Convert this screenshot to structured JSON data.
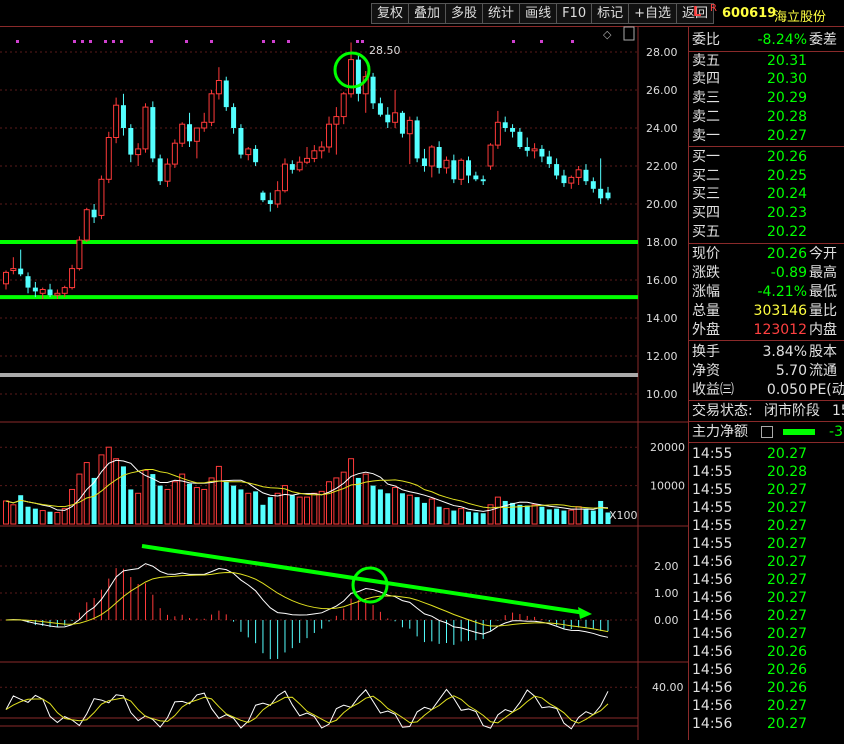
{
  "toolbar": {
    "buttons": [
      "复权",
      "叠加",
      "多股",
      "统计",
      "画线",
      "F10",
      "标记",
      "+自选",
      "返回"
    ],
    "mode_label": "L",
    "mode_r": "R",
    "stock_code": "600619",
    "stock_name": "海立股份"
  },
  "colors": {
    "up": "#ff3a3a",
    "down": "#54ffff",
    "green": "#00ff00",
    "yellow": "#e0e020",
    "white": "#ffffff"
  },
  "main_chart": {
    "high_label": "28.50",
    "price_axis": [
      "28.00",
      "26.00",
      "24.00",
      "22.00",
      "20.00",
      "18.00",
      "16.00",
      "14.00",
      "12.00",
      "10.00"
    ],
    "support_lines": [
      18.0,
      15.1
    ],
    "gray_line": 11.0
  },
  "volume_chart": {
    "axis": [
      "20000",
      "10000"
    ],
    "unit_label": "X100"
  },
  "macd_chart": {
    "axis": [
      "2.00",
      "1.00",
      "0.00"
    ]
  },
  "kdj_chart": {
    "axis": [
      "40.00"
    ]
  },
  "order_book": {
    "weibi_label": "委比",
    "weibi_value": "-8.24%",
    "weicha_label": "委差",
    "sells": [
      {
        "label": "卖五",
        "price": "20.31"
      },
      {
        "label": "卖四",
        "price": "20.30"
      },
      {
        "label": "卖三",
        "price": "20.29"
      },
      {
        "label": "卖二",
        "price": "20.28"
      },
      {
        "label": "卖一",
        "price": "20.27"
      }
    ],
    "buys": [
      {
        "label": "买一",
        "price": "20.26"
      },
      {
        "label": "买二",
        "price": "20.25"
      },
      {
        "label": "买三",
        "price": "20.24"
      },
      {
        "label": "买四",
        "price": "20.23"
      },
      {
        "label": "买五",
        "price": "20.22"
      }
    ]
  },
  "quote": [
    {
      "label": "现价",
      "value": "20.26",
      "right": "今开",
      "color": "g"
    },
    {
      "label": "涨跌",
      "value": "-0.89",
      "right": "最高",
      "color": "g"
    },
    {
      "label": "涨幅",
      "value": "-4.21%",
      "right": "最低",
      "color": "g"
    },
    {
      "label": "总量",
      "value": "303146",
      "right": "量比",
      "color": "y"
    },
    {
      "label": "外盘",
      "value": "123012",
      "right": "内盘",
      "color": "r"
    }
  ],
  "fundamentals": [
    {
      "label": "换手",
      "value": "3.84%",
      "right": "股本"
    },
    {
      "label": "净资",
      "value": "5.70",
      "right": "流通"
    },
    {
      "label": "收益㈢",
      "value": "0.050",
      "right": "PE(动"
    }
  ],
  "status": {
    "label": "交易状态:",
    "value": "闭市阶段",
    "suffix": "15"
  },
  "main_flow": {
    "label": "主力净额",
    "value": "-3"
  },
  "ticks": [
    {
      "time": "14:55",
      "price": "20.27"
    },
    {
      "time": "14:55",
      "price": "20.28"
    },
    {
      "time": "14:55",
      "price": "20.27"
    },
    {
      "time": "14:55",
      "price": "20.27"
    },
    {
      "time": "14:55",
      "price": "20.27"
    },
    {
      "time": "14:55",
      "price": "20.27"
    },
    {
      "time": "14:56",
      "price": "20.27"
    },
    {
      "time": "14:56",
      "price": "20.27"
    },
    {
      "time": "14:56",
      "price": "20.27"
    },
    {
      "time": "14:56",
      "price": "20.27"
    },
    {
      "time": "14:56",
      "price": "20.27"
    },
    {
      "time": "14:56",
      "price": "20.26"
    },
    {
      "time": "14:56",
      "price": "20.26"
    },
    {
      "time": "14:56",
      "price": "20.26"
    },
    {
      "time": "14:56",
      "price": "20.27"
    },
    {
      "time": "14:56",
      "price": "20.27"
    }
  ]
}
